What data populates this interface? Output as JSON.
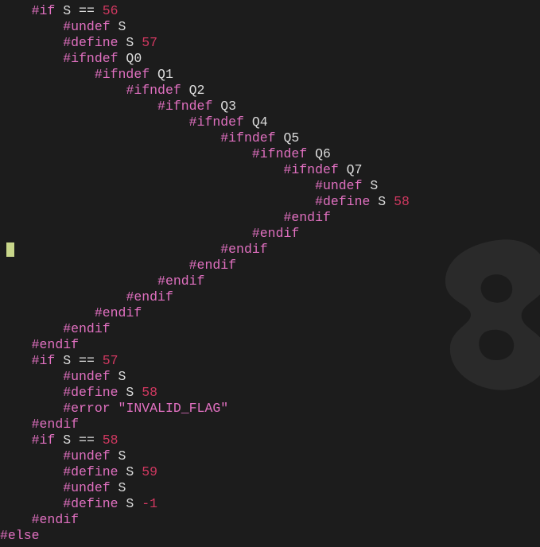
{
  "editor": {
    "colors": {
      "background": "#1c1c1c",
      "directive": "#e070c0",
      "identifier": "#dcdcdc",
      "number": "#d03860",
      "cursor": "#c8d68a"
    },
    "watermark_icon": "logo-watermark-icon",
    "cursor_line": 16,
    "lines": [
      {
        "indent": 1,
        "tokens": [
          {
            "t": "directive",
            "v": "#if"
          },
          {
            "t": "ident",
            "v": " S "
          },
          {
            "t": "op",
            "v": "=="
          },
          {
            "t": "num",
            "v": " 56"
          }
        ]
      },
      {
        "indent": 2,
        "tokens": [
          {
            "t": "directive",
            "v": "#undef"
          },
          {
            "t": "ident",
            "v": " S"
          }
        ]
      },
      {
        "indent": 2,
        "tokens": [
          {
            "t": "directive",
            "v": "#define"
          },
          {
            "t": "ident",
            "v": " S"
          },
          {
            "t": "num",
            "v": " 57"
          }
        ]
      },
      {
        "indent": 2,
        "tokens": [
          {
            "t": "directive",
            "v": "#ifndef"
          },
          {
            "t": "ident",
            "v": " Q0"
          }
        ]
      },
      {
        "indent": 3,
        "tokens": [
          {
            "t": "directive",
            "v": "#ifndef"
          },
          {
            "t": "ident",
            "v": " Q1"
          }
        ]
      },
      {
        "indent": 4,
        "tokens": [
          {
            "t": "directive",
            "v": "#ifndef"
          },
          {
            "t": "ident",
            "v": " Q2"
          }
        ]
      },
      {
        "indent": 5,
        "tokens": [
          {
            "t": "directive",
            "v": "#ifndef"
          },
          {
            "t": "ident",
            "v": " Q3"
          }
        ]
      },
      {
        "indent": 6,
        "tokens": [
          {
            "t": "directive",
            "v": "#ifndef"
          },
          {
            "t": "ident",
            "v": " Q4"
          }
        ]
      },
      {
        "indent": 7,
        "tokens": [
          {
            "t": "directive",
            "v": "#ifndef"
          },
          {
            "t": "ident",
            "v": " Q5"
          }
        ]
      },
      {
        "indent": 8,
        "tokens": [
          {
            "t": "directive",
            "v": "#ifndef"
          },
          {
            "t": "ident",
            "v": " Q6"
          }
        ]
      },
      {
        "indent": 9,
        "tokens": [
          {
            "t": "directive",
            "v": "#ifndef"
          },
          {
            "t": "ident",
            "v": " Q7"
          }
        ]
      },
      {
        "indent": 10,
        "tokens": [
          {
            "t": "directive",
            "v": "#undef"
          },
          {
            "t": "ident",
            "v": " S"
          }
        ]
      },
      {
        "indent": 10,
        "tokens": [
          {
            "t": "directive",
            "v": "#define"
          },
          {
            "t": "ident",
            "v": " S"
          },
          {
            "t": "num",
            "v": " 58"
          }
        ]
      },
      {
        "indent": 9,
        "tokens": [
          {
            "t": "directive",
            "v": "#endif"
          }
        ]
      },
      {
        "indent": 8,
        "tokens": [
          {
            "t": "directive",
            "v": "#endif"
          }
        ]
      },
      {
        "indent": 7,
        "tokens": [
          {
            "t": "directive",
            "v": "#endif"
          }
        ]
      },
      {
        "indent": 6,
        "tokens": [
          {
            "t": "directive",
            "v": "#endif"
          }
        ]
      },
      {
        "indent": 5,
        "tokens": [
          {
            "t": "directive",
            "v": "#endif"
          }
        ]
      },
      {
        "indent": 4,
        "tokens": [
          {
            "t": "directive",
            "v": "#endif"
          }
        ]
      },
      {
        "indent": 3,
        "tokens": [
          {
            "t": "directive",
            "v": "#endif"
          }
        ]
      },
      {
        "indent": 2,
        "tokens": [
          {
            "t": "directive",
            "v": "#endif"
          }
        ]
      },
      {
        "indent": 1,
        "tokens": [
          {
            "t": "directive",
            "v": "#endif"
          }
        ]
      },
      {
        "indent": 1,
        "tokens": [
          {
            "t": "directive",
            "v": "#if"
          },
          {
            "t": "ident",
            "v": " S "
          },
          {
            "t": "op",
            "v": "=="
          },
          {
            "t": "num",
            "v": " 57"
          }
        ]
      },
      {
        "indent": 2,
        "tokens": [
          {
            "t": "directive",
            "v": "#undef"
          },
          {
            "t": "ident",
            "v": " S"
          }
        ]
      },
      {
        "indent": 2,
        "tokens": [
          {
            "t": "directive",
            "v": "#define"
          },
          {
            "t": "ident",
            "v": " S"
          },
          {
            "t": "num",
            "v": " 58"
          }
        ]
      },
      {
        "indent": 2,
        "tokens": [
          {
            "t": "directive",
            "v": "#error"
          },
          {
            "t": "str",
            "v": " \"INVALID_FLAG\""
          }
        ]
      },
      {
        "indent": 1,
        "tokens": [
          {
            "t": "directive",
            "v": "#endif"
          }
        ]
      },
      {
        "indent": 1,
        "tokens": [
          {
            "t": "directive",
            "v": "#if"
          },
          {
            "t": "ident",
            "v": " S "
          },
          {
            "t": "op",
            "v": "=="
          },
          {
            "t": "num",
            "v": " 58"
          }
        ]
      },
      {
        "indent": 2,
        "tokens": [
          {
            "t": "directive",
            "v": "#undef"
          },
          {
            "t": "ident",
            "v": " S"
          }
        ]
      },
      {
        "indent": 2,
        "tokens": [
          {
            "t": "directive",
            "v": "#define"
          },
          {
            "t": "ident",
            "v": " S"
          },
          {
            "t": "num",
            "v": " 59"
          }
        ]
      },
      {
        "indent": 2,
        "tokens": [
          {
            "t": "directive",
            "v": "#undef"
          },
          {
            "t": "ident",
            "v": " S"
          }
        ]
      },
      {
        "indent": 2,
        "tokens": [
          {
            "t": "directive",
            "v": "#define"
          },
          {
            "t": "ident",
            "v": " S"
          },
          {
            "t": "num",
            "v": " -1"
          }
        ]
      },
      {
        "indent": 1,
        "tokens": [
          {
            "t": "directive",
            "v": "#endif"
          }
        ]
      },
      {
        "indent": 0,
        "tokens": [
          {
            "t": "directive",
            "v": "#else"
          }
        ]
      }
    ]
  }
}
